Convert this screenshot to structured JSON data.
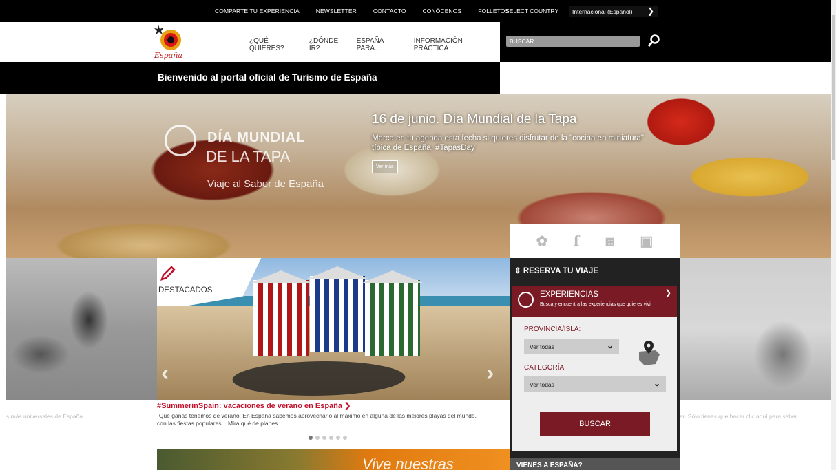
{
  "topbar": {
    "links": [
      "COMPARTE TU EXPERIENCIA",
      "NEWSLETTER",
      "CONTACTO",
      "CONÓCENOS",
      "FOLLETOS"
    ],
    "country_label": "SELECT COUNTRY",
    "country_value": "Internacional (Español)"
  },
  "header": {
    "logo_text": "España",
    "nav": [
      "¿QUÉ QUIERES?",
      "¿DÓNDE IR?",
      "ESPAÑA PARA...",
      "INFORMACIÓN PRÁCTICA"
    ],
    "search_placeholder": "BUSCAR"
  },
  "welcome": "Bienvenido al portal oficial de Turismo de España",
  "hero": {
    "logo_line1": "DÍA MUNDIAL",
    "logo_line2": "DE LA TAPA",
    "logo_line3": "Viaje al Sabor de España",
    "headline": "16 de junio. Día Mundial de la Tapa",
    "description": "Marca en tu agenda esta fecha si quieres disfrutar de la \"cocina en miniatura\" típica de España. #TapasDay",
    "cta": "Ver más"
  },
  "side": {
    "left_caption": "s más universales de España.",
    "right_caption": "ar. Sólo tienes que hacer clic aquí para saber"
  },
  "featured": {
    "label": "DESTACADOS",
    "title": "#SummerinSpain: vacaciones de verano en España",
    "description": "¡Qué ganas tenemos de verano! En España sabemos aprovecharlo al máximo en alguna de las mejores playas del mundo, con las fiestas populares... Mira qué de planes.",
    "slides_total": 6,
    "slide_active": 1
  },
  "promo_text": "Vive nuestras",
  "booking": {
    "title": "RESERVA TU VIAJE",
    "section_title": "EXPERIENCIAS",
    "section_sub": "Busca y encuentra las experiencias que quieres vivir",
    "province_label": "PROVINCIA/ISLA:",
    "province_value": "Ver todas",
    "category_label": "CATEGORÍA:",
    "category_value": "Ver todas",
    "search_button": "BUSCAR",
    "next_section": "VIENES A ESPAÑA?"
  },
  "social_icons": [
    "twitter-icon",
    "facebook-icon",
    "youtube-icon",
    "instagram-icon"
  ],
  "colors": {
    "brand_red": "#7a1a24",
    "accent_red": "#c0102a",
    "topbar_bg": "#000000"
  }
}
